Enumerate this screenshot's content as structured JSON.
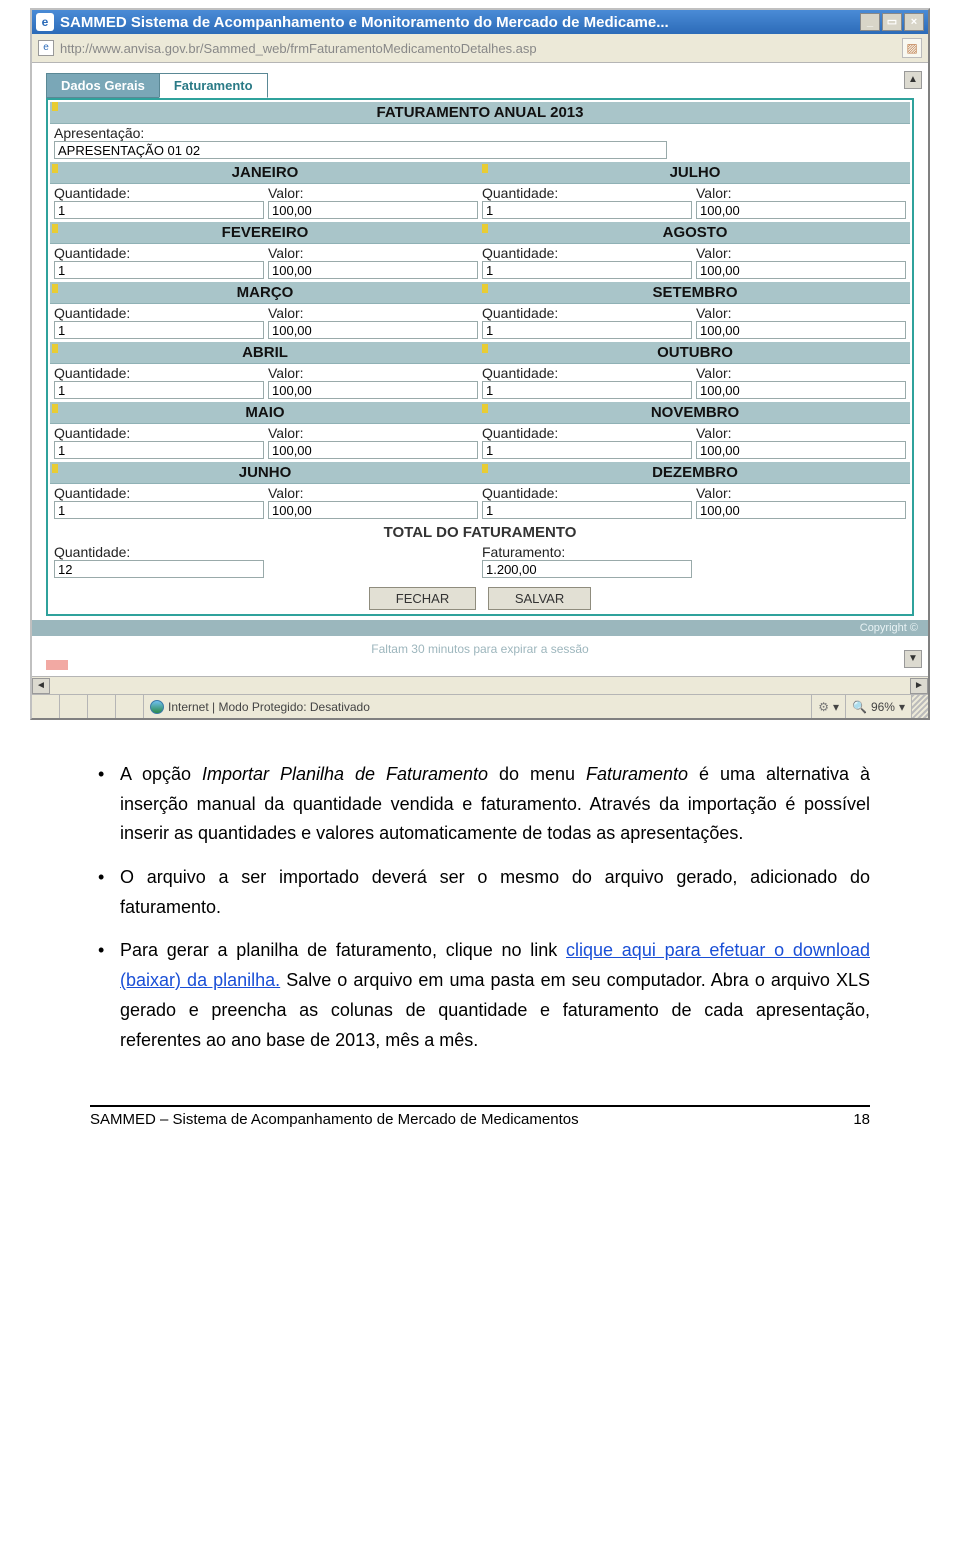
{
  "window": {
    "title": "SAMMED Sistema de Acompanhamento e Monitoramento do Mercado de Medicame...",
    "url": "http://www.anvisa.gov.br/Sammed_web/frmFaturamentoMedicamentoDetalhes.asp"
  },
  "tabs": {
    "geral": "Dados Gerais",
    "fat": "Faturamento"
  },
  "panel": {
    "year_title": "FATURAMENTO ANUAL 2013",
    "presentation_label": "Apresentação:",
    "presentation_value": "APRESENTAÇÃO 01 02",
    "qty_label": "Quantidade:",
    "val_label": "Valor:",
    "fat_label": "Faturamento:",
    "months": [
      {
        "left": "JANEIRO",
        "right": "JULHO",
        "lq": "1",
        "lv": "100,00",
        "rq": "1",
        "rv": "100,00"
      },
      {
        "left": "FEVEREIRO",
        "right": "AGOSTO",
        "lq": "1",
        "lv": "100,00",
        "rq": "1",
        "rv": "100,00"
      },
      {
        "left": "MARÇO",
        "right": "SETEMBRO",
        "lq": "1",
        "lv": "100,00",
        "rq": "1",
        "rv": "100,00"
      },
      {
        "left": "ABRIL",
        "right": "OUTUBRO",
        "lq": "1",
        "lv": "100,00",
        "rq": "1",
        "rv": "100,00"
      },
      {
        "left": "MAIO",
        "right": "NOVEMBRO",
        "lq": "1",
        "lv": "100,00",
        "rq": "1",
        "rv": "100,00"
      },
      {
        "left": "JUNHO",
        "right": "DEZEMBRO",
        "lq": "1",
        "lv": "100,00",
        "rq": "1",
        "rv": "100,00"
      }
    ],
    "total_title": "TOTAL DO FATURAMENTO",
    "total_qty": "12",
    "total_fat": "1.200,00",
    "btn_close": "FECHAR",
    "btn_save": "SALVAR"
  },
  "copyright": "Copyright ©",
  "session": "Faltam 30 minutos para expirar a sessão",
  "statusbar": {
    "zone": "Internet | Modo Protegido: Desativado",
    "zoom": "96%"
  },
  "doc": {
    "b1a": "A opção ",
    "b1b": "Importar Planilha de Faturamento",
    "b1c": " do menu ",
    "b1d": "Faturamento",
    "b1e": " é uma alternativa à inserção manual da quantidade vendida e faturamento. Através da importação é possível inserir as quantidades e valores automaticamente de todas as apresentações.",
    "b2": "O arquivo a ser importado deverá ser o mesmo do arquivo gerado, adicionado do faturamento.",
    "b3a": "Para gerar a planilha de faturamento, clique no link ",
    "b3link": "clique aqui para efetuar o download (baixar) da planilha.",
    "b3b": " Salve o arquivo em uma pasta em seu computador. Abra o arquivo XLS gerado e preencha as colunas de quantidade e faturamento de cada apresentação, referentes ao ano base de 2013, mês a mês."
  },
  "footer": {
    "left": "SAMMED – Sistema de Acompanhamento de Mercado de Medicamentos",
    "right": "18"
  }
}
